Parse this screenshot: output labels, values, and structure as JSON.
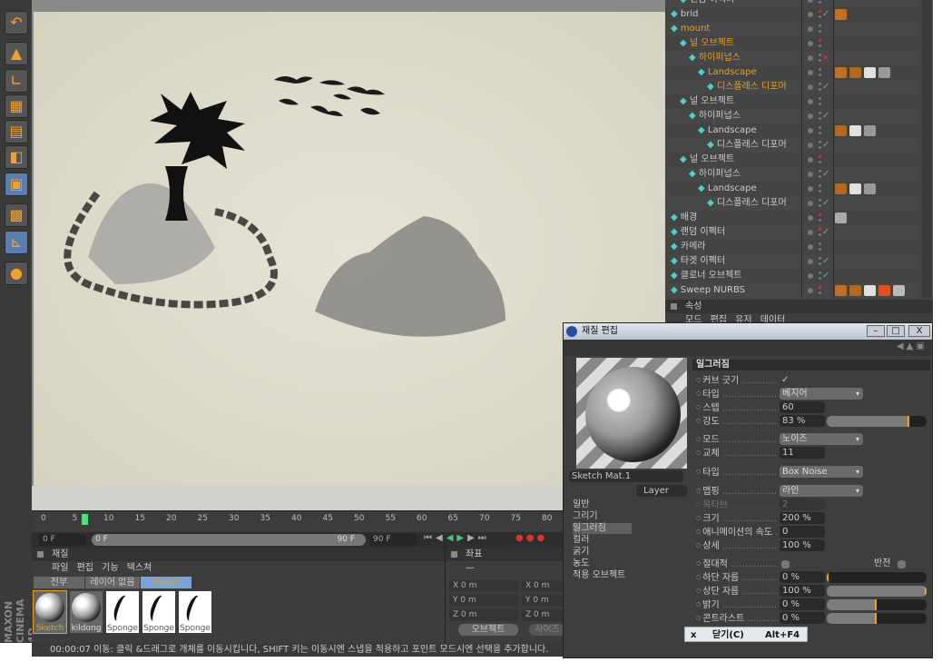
{
  "object_manager": {
    "rows": [
      {
        "name": "랜덤 이펙터",
        "depth": 1,
        "active": false
      },
      {
        "name": "brid",
        "depth": 0,
        "active": false,
        "red": true,
        "check": true,
        "tags": [
          "#c07020"
        ]
      },
      {
        "name": "mount",
        "depth": 0,
        "active": true
      },
      {
        "name": "널 오브젝트",
        "depth": 1,
        "active": true,
        "red": true
      },
      {
        "name": "하이퍼넙스",
        "depth": 2,
        "active": true,
        "x": true
      },
      {
        "name": "Landscape",
        "depth": 3,
        "active": true,
        "tags": [
          "#c07020",
          "#b06a20",
          "#e0e0e0",
          "#999"
        ]
      },
      {
        "name": "디스플레스 디포머",
        "depth": 4,
        "active": true,
        "check": true
      },
      {
        "name": "널 오브젝트",
        "depth": 1,
        "active": false
      },
      {
        "name": "하이퍼넙스",
        "depth": 2,
        "active": false,
        "check": true
      },
      {
        "name": "Landscape",
        "depth": 3,
        "active": false,
        "tags": [
          "#b06a20",
          "#e0e0e0",
          "#999"
        ]
      },
      {
        "name": "디스플레스 디포머",
        "depth": 4,
        "active": false,
        "check": true
      },
      {
        "name": "널 오브젝트",
        "depth": 1,
        "active": false,
        "red": true
      },
      {
        "name": "하이퍼넙스",
        "depth": 2,
        "active": false,
        "check": true
      },
      {
        "name": "Landscape",
        "depth": 3,
        "active": false,
        "tags": [
          "#b06a20",
          "#e0e0e0",
          "#999"
        ]
      },
      {
        "name": "디스플레스 디포머",
        "depth": 4,
        "active": false,
        "check": true
      },
      {
        "name": "배경",
        "depth": 0,
        "active": false,
        "red": true,
        "tags": [
          "#aaa"
        ]
      },
      {
        "name": "랜덤 이펙터",
        "depth": 0,
        "active": false,
        "red": true,
        "check": true
      },
      {
        "name": "카메라",
        "depth": 0,
        "active": false
      },
      {
        "name": "타겟 이펙터",
        "depth": 0,
        "active": false,
        "check": true
      },
      {
        "name": "클로너 오브젝트",
        "depth": 0,
        "active": false,
        "check": true
      },
      {
        "name": "Sweep NURBS",
        "depth": 0,
        "active": false,
        "red": true,
        "tags": [
          "#c07020",
          "#b06a20",
          "#e0e0e0",
          "#e05020",
          "#bbb"
        ]
      }
    ]
  },
  "attributes": {
    "title": "속성",
    "menu": "모드 편집 유저 데이터"
  },
  "timeline": {
    "ticks": [
      "0",
      "5",
      "10",
      "15",
      "20",
      "25",
      "30",
      "35",
      "40",
      "45",
      "50",
      "55",
      "60",
      "65",
      "70",
      "75",
      "80"
    ],
    "current_frame": 7,
    "start": "0 F",
    "range_start": "0 F",
    "range_end": "90 F",
    "end": "90 F"
  },
  "materials": {
    "title": "재질",
    "menu": "파일 편집 기능 텍스쳐",
    "filters": [
      "전부",
      "레이어 없음",
      "Paper"
    ],
    "items": [
      "Sketch",
      "kildong",
      "Sponge",
      "Sponge",
      "Sponge"
    ]
  },
  "coords": {
    "title": "좌표",
    "rows": [
      [
        "X",
        "0 m",
        "X",
        "0 m"
      ],
      [
        "Y",
        "0 m",
        "Y",
        "0 m"
      ],
      [
        "Z",
        "0 m",
        "Z",
        "0 m"
      ]
    ],
    "mode": "오브젝트",
    "size": "사이즈"
  },
  "status": "00:00:07  이동: 클릭 &드래그로 개체를 이동시킵니다, SHIFT 키는 이동시엔 스냅을 적용하고 포인트 모드시엔 선택을 추가합니다.",
  "logo": "MAXON CINEMA 4D",
  "material_editor": {
    "title": "재질 편집",
    "material_name": "Sketch Mat.1",
    "layer": "Layer",
    "nav": [
      "일반",
      "그리기",
      "일그러짐",
      "컬러",
      "굵기",
      "농도",
      "적용 오브젝트"
    ],
    "nav_selected": 2,
    "section": "일그러짐",
    "params": [
      {
        "label": "커브 긋기",
        "check": "✓"
      },
      {
        "label": "타입",
        "dropdown": "베지어"
      },
      {
        "label": "스텝",
        "value": "60"
      },
      {
        "label": "강도",
        "value": "83 %",
        "bar": 83
      },
      {
        "label": "모드",
        "dropdown": "노이즈"
      },
      {
        "label": "교체",
        "value": "11"
      },
      {
        "label": "타입",
        "dropdown": "Box Noise"
      },
      {
        "label": "맵핑",
        "dropdown": "라인"
      },
      {
        "label": "옥타브",
        "value": "2",
        "disabled": true
      },
      {
        "label": "크기",
        "value": "200 %"
      },
      {
        "label": "애니메이션의 속도",
        "value": "0"
      },
      {
        "label": "상세",
        "value": "100 %"
      },
      {
        "label": "절대적",
        "toggle": false,
        "extra": "반전"
      },
      {
        "label": "하단 자름",
        "value": "0 %",
        "bar": 0
      },
      {
        "label": "상단 자름",
        "value": "100 %",
        "bar": 100
      },
      {
        "label": "밝기",
        "value": "0 %",
        "bar": 50
      },
      {
        "label": "콘트라스트",
        "value": "0 %",
        "bar": 50
      }
    ]
  },
  "context_menu": {
    "icon": "x",
    "label": "닫기(C)",
    "shortcut": "Alt+F4"
  },
  "colors": {
    "accent": "#f0a020",
    "active_object": "#e0a030",
    "selection": "#5a7fae"
  }
}
